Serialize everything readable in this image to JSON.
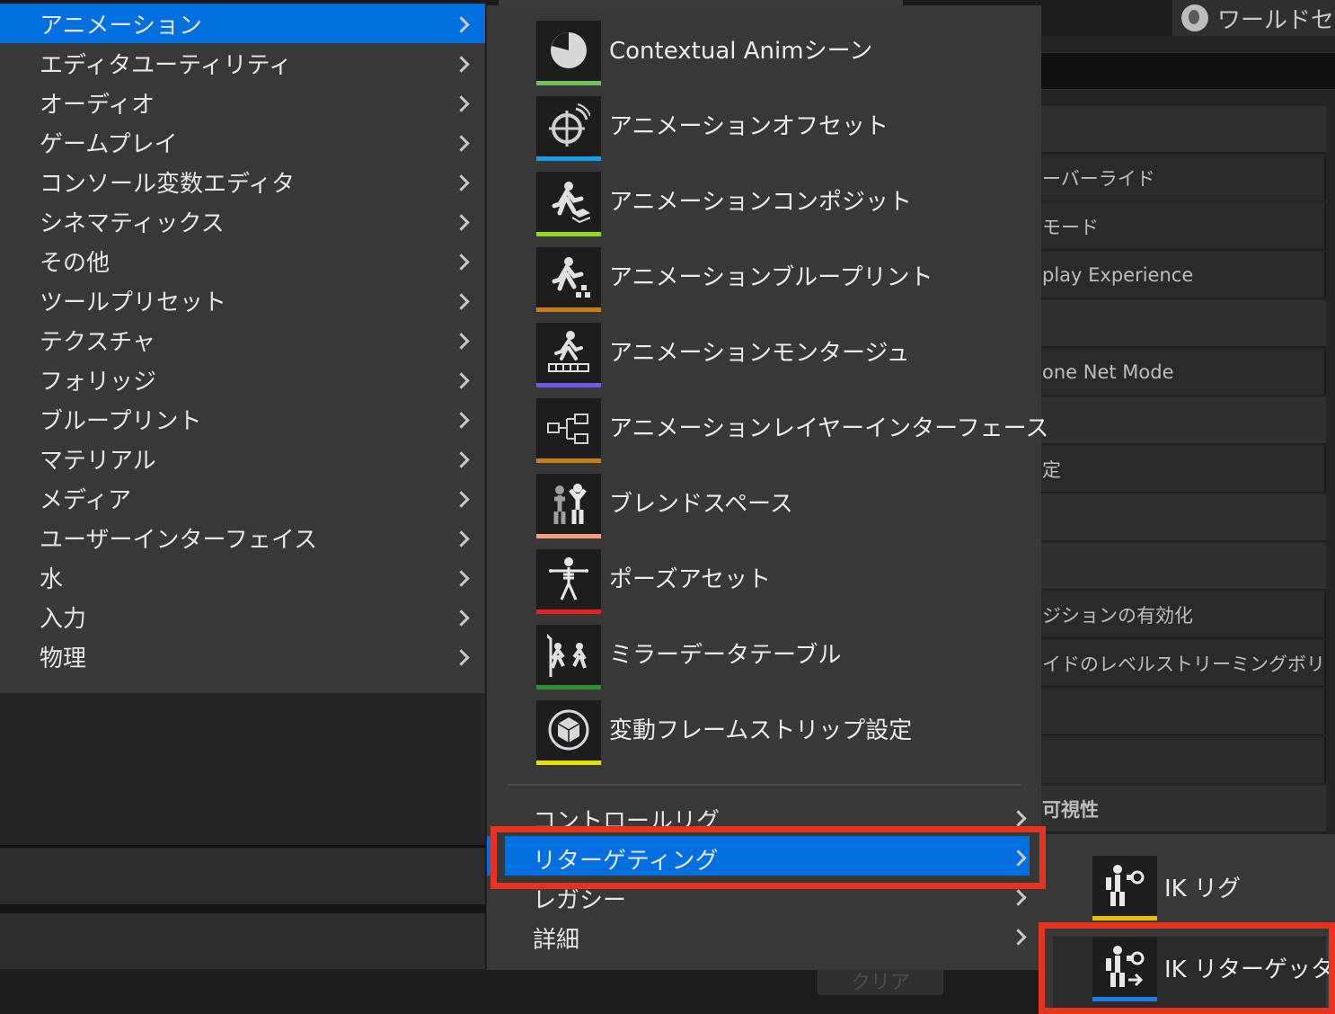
{
  "background": {
    "world_tab_label": "ワールドセ",
    "clear_button": "クリア",
    "detail_rows": [
      "ーバーライド",
      "モード",
      "play Experience",
      "one Net Mode",
      "定",
      "ジションの有効化",
      "イドのレベルストリーミングボリュ...",
      "可視性"
    ]
  },
  "left_menu": {
    "items": [
      {
        "label": "アニメーション",
        "active": true
      },
      {
        "label": "エディタユーティリティ"
      },
      {
        "label": "オーディオ"
      },
      {
        "label": "ゲームプレイ"
      },
      {
        "label": "コンソール変数エディタ"
      },
      {
        "label": "シネマティックス"
      },
      {
        "label": "その他"
      },
      {
        "label": "ツールプリセット"
      },
      {
        "label": "テクスチャ"
      },
      {
        "label": "フォリッジ"
      },
      {
        "label": "ブループリント"
      },
      {
        "label": "マテリアル"
      },
      {
        "label": "メディア"
      },
      {
        "label": "ユーザーインターフェイス"
      },
      {
        "label": "水"
      },
      {
        "label": "入力"
      },
      {
        "label": "物理"
      }
    ]
  },
  "animation_submenu": {
    "assets": [
      {
        "label": "Contextual Animシーン",
        "icon": "pie-chart-icon",
        "color": "#6fbf5a"
      },
      {
        "label": "アニメーションオフセット",
        "icon": "aim-offset-icon",
        "color": "#1a9be8"
      },
      {
        "label": "アニメーションコンポジット",
        "icon": "anim-composite-icon",
        "color": "#8fdb1c"
      },
      {
        "label": "アニメーションブループリント",
        "icon": "anim-blueprint-icon",
        "color": "#c87d17"
      },
      {
        "label": "アニメーションモンタージュ",
        "icon": "anim-montage-icon",
        "color": "#6a5ce8"
      },
      {
        "label": "アニメーションレイヤーインターフェース",
        "icon": "anim-layer-interface-icon",
        "color": "#c87d17"
      },
      {
        "label": "ブレンドスペース",
        "icon": "blendspace-icon",
        "color": "#f4a07a"
      },
      {
        "label": "ポーズアセット",
        "icon": "pose-asset-icon",
        "color": "#e52020"
      },
      {
        "label": "ミラーデータテーブル",
        "icon": "mirror-table-icon",
        "color": "#2f8f2f"
      },
      {
        "label": "変動フレームストリップ設定",
        "icon": "frame-strip-icon",
        "color": "#e8e000"
      }
    ],
    "submenus": [
      {
        "label": "コントロールリグ"
      },
      {
        "label": "リターゲティング",
        "active": true
      },
      {
        "label": "レガシー"
      },
      {
        "label": "詳細"
      }
    ]
  },
  "retargeting_submenu": {
    "assets": [
      {
        "label": "IK リグ",
        "icon": "ik-rig-icon",
        "color": "#e8c000"
      },
      {
        "label": "IK リターゲッタ",
        "icon": "ik-retargeter-icon",
        "color": "#1a7de8"
      }
    ]
  }
}
